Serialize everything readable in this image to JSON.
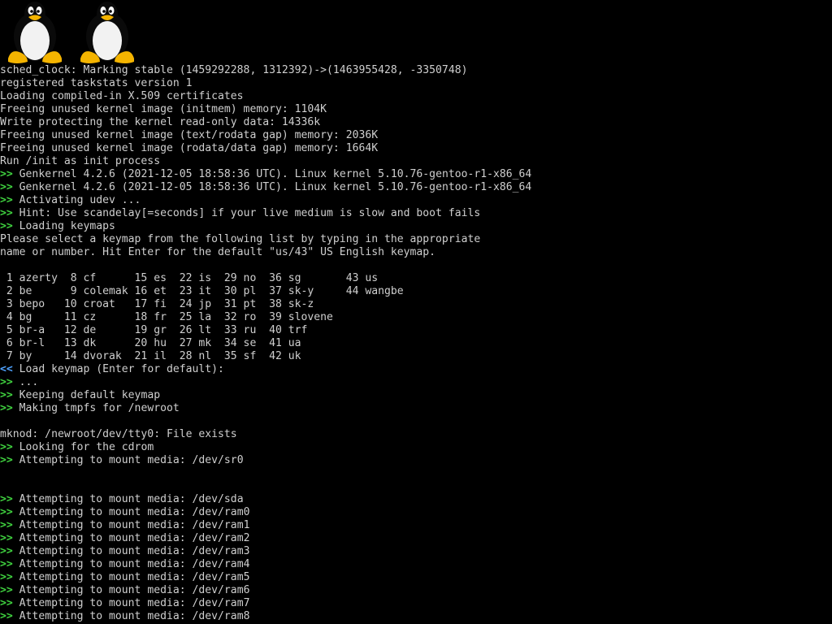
{
  "logos": [
    {
      "name": "tux-logo-1",
      "icon": "tux-penguin-icon"
    },
    {
      "name": "tux-logo-2",
      "icon": "tux-penguin-icon"
    }
  ],
  "colors": {
    "background": "#000000",
    "text": "#cfcfcf",
    "prompt_green": "#3fd13f",
    "prompt_blue": "#4fa3ff"
  },
  "console": {
    "lines": [
      {
        "prefix": "",
        "text": "sched_clock: Marking stable (1459292288, 1312392)->(1463955428, -3350748)"
      },
      {
        "prefix": "",
        "text": "registered taskstats version 1"
      },
      {
        "prefix": "",
        "text": "Loading compiled-in X.509 certificates"
      },
      {
        "prefix": "",
        "text": "Freeing unused kernel image (initmem) memory: 1104K"
      },
      {
        "prefix": "",
        "text": "Write protecting the kernel read-only data: 14336k"
      },
      {
        "prefix": "",
        "text": "Freeing unused kernel image (text/rodata gap) memory: 2036K"
      },
      {
        "prefix": "",
        "text": "Freeing unused kernel image (rodata/data gap) memory: 1664K"
      },
      {
        "prefix": "",
        "text": "Run /init as init process"
      },
      {
        "prefix": ">>",
        "text": " Genkernel 4.2.6 (2021-12-05 18:58:36 UTC). Linux kernel 5.10.76-gentoo-r1-x86_64"
      },
      {
        "prefix": ">>",
        "text": " Genkernel 4.2.6 (2021-12-05 18:58:36 UTC). Linux kernel 5.10.76-gentoo-r1-x86_64"
      },
      {
        "prefix": ">>",
        "text": " Activating udev ..."
      },
      {
        "prefix": ">>",
        "text": " Hint: Use scandelay[=seconds] if your live medium is slow and boot fails"
      },
      {
        "prefix": ">>",
        "text": " Loading keymaps"
      },
      {
        "prefix": "",
        "text": "Please select a keymap from the following list by typing in the appropriate"
      },
      {
        "prefix": "",
        "text": "name or number. Hit Enter for the default \"us/43\" US English keymap."
      },
      {
        "prefix": "",
        "text": ""
      },
      {
        "prefix": "",
        "text": " 1 azerty  8 cf      15 es  22 is  29 no  36 sg       43 us"
      },
      {
        "prefix": "",
        "text": " 2 be      9 colemak 16 et  23 it  30 pl  37 sk-y     44 wangbe"
      },
      {
        "prefix": "",
        "text": " 3 bepo   10 croat   17 fi  24 jp  31 pt  38 sk-z"
      },
      {
        "prefix": "",
        "text": " 4 bg     11 cz      18 fr  25 la  32 ro  39 slovene"
      },
      {
        "prefix": "",
        "text": " 5 br-a   12 de      19 gr  26 lt  33 ru  40 trf"
      },
      {
        "prefix": "",
        "text": " 6 br-l   13 dk      20 hu  27 mk  34 se  41 ua"
      },
      {
        "prefix": "",
        "text": " 7 by     14 dvorak  21 il  28 nl  35 sf  42 uk"
      },
      {
        "prefix": "<<",
        "text": " Load keymap (Enter for default):"
      },
      {
        "prefix": ">>",
        "text": " ..."
      },
      {
        "prefix": ">>",
        "text": " Keeping default keymap"
      },
      {
        "prefix": ">>",
        "text": " Making tmpfs for /newroot"
      },
      {
        "prefix": "",
        "text": ""
      },
      {
        "prefix": "",
        "text": "mknod: /newroot/dev/tty0: File exists"
      },
      {
        "prefix": ">>",
        "text": " Looking for the cdrom"
      },
      {
        "prefix": ">>",
        "text": " Attempting to mount media: /dev/sr0"
      },
      {
        "prefix": "",
        "text": ""
      },
      {
        "prefix": "",
        "text": ""
      },
      {
        "prefix": ">>",
        "text": " Attempting to mount media: /dev/sda"
      },
      {
        "prefix": ">>",
        "text": " Attempting to mount media: /dev/ram0"
      },
      {
        "prefix": ">>",
        "text": " Attempting to mount media: /dev/ram1"
      },
      {
        "prefix": ">>",
        "text": " Attempting to mount media: /dev/ram2"
      },
      {
        "prefix": ">>",
        "text": " Attempting to mount media: /dev/ram3"
      },
      {
        "prefix": ">>",
        "text": " Attempting to mount media: /dev/ram4"
      },
      {
        "prefix": ">>",
        "text": " Attempting to mount media: /dev/ram5"
      },
      {
        "prefix": ">>",
        "text": " Attempting to mount media: /dev/ram6"
      },
      {
        "prefix": ">>",
        "text": " Attempting to mount media: /dev/ram7"
      },
      {
        "prefix": ">>",
        "text": " Attempting to mount media: /dev/ram8"
      }
    ]
  }
}
